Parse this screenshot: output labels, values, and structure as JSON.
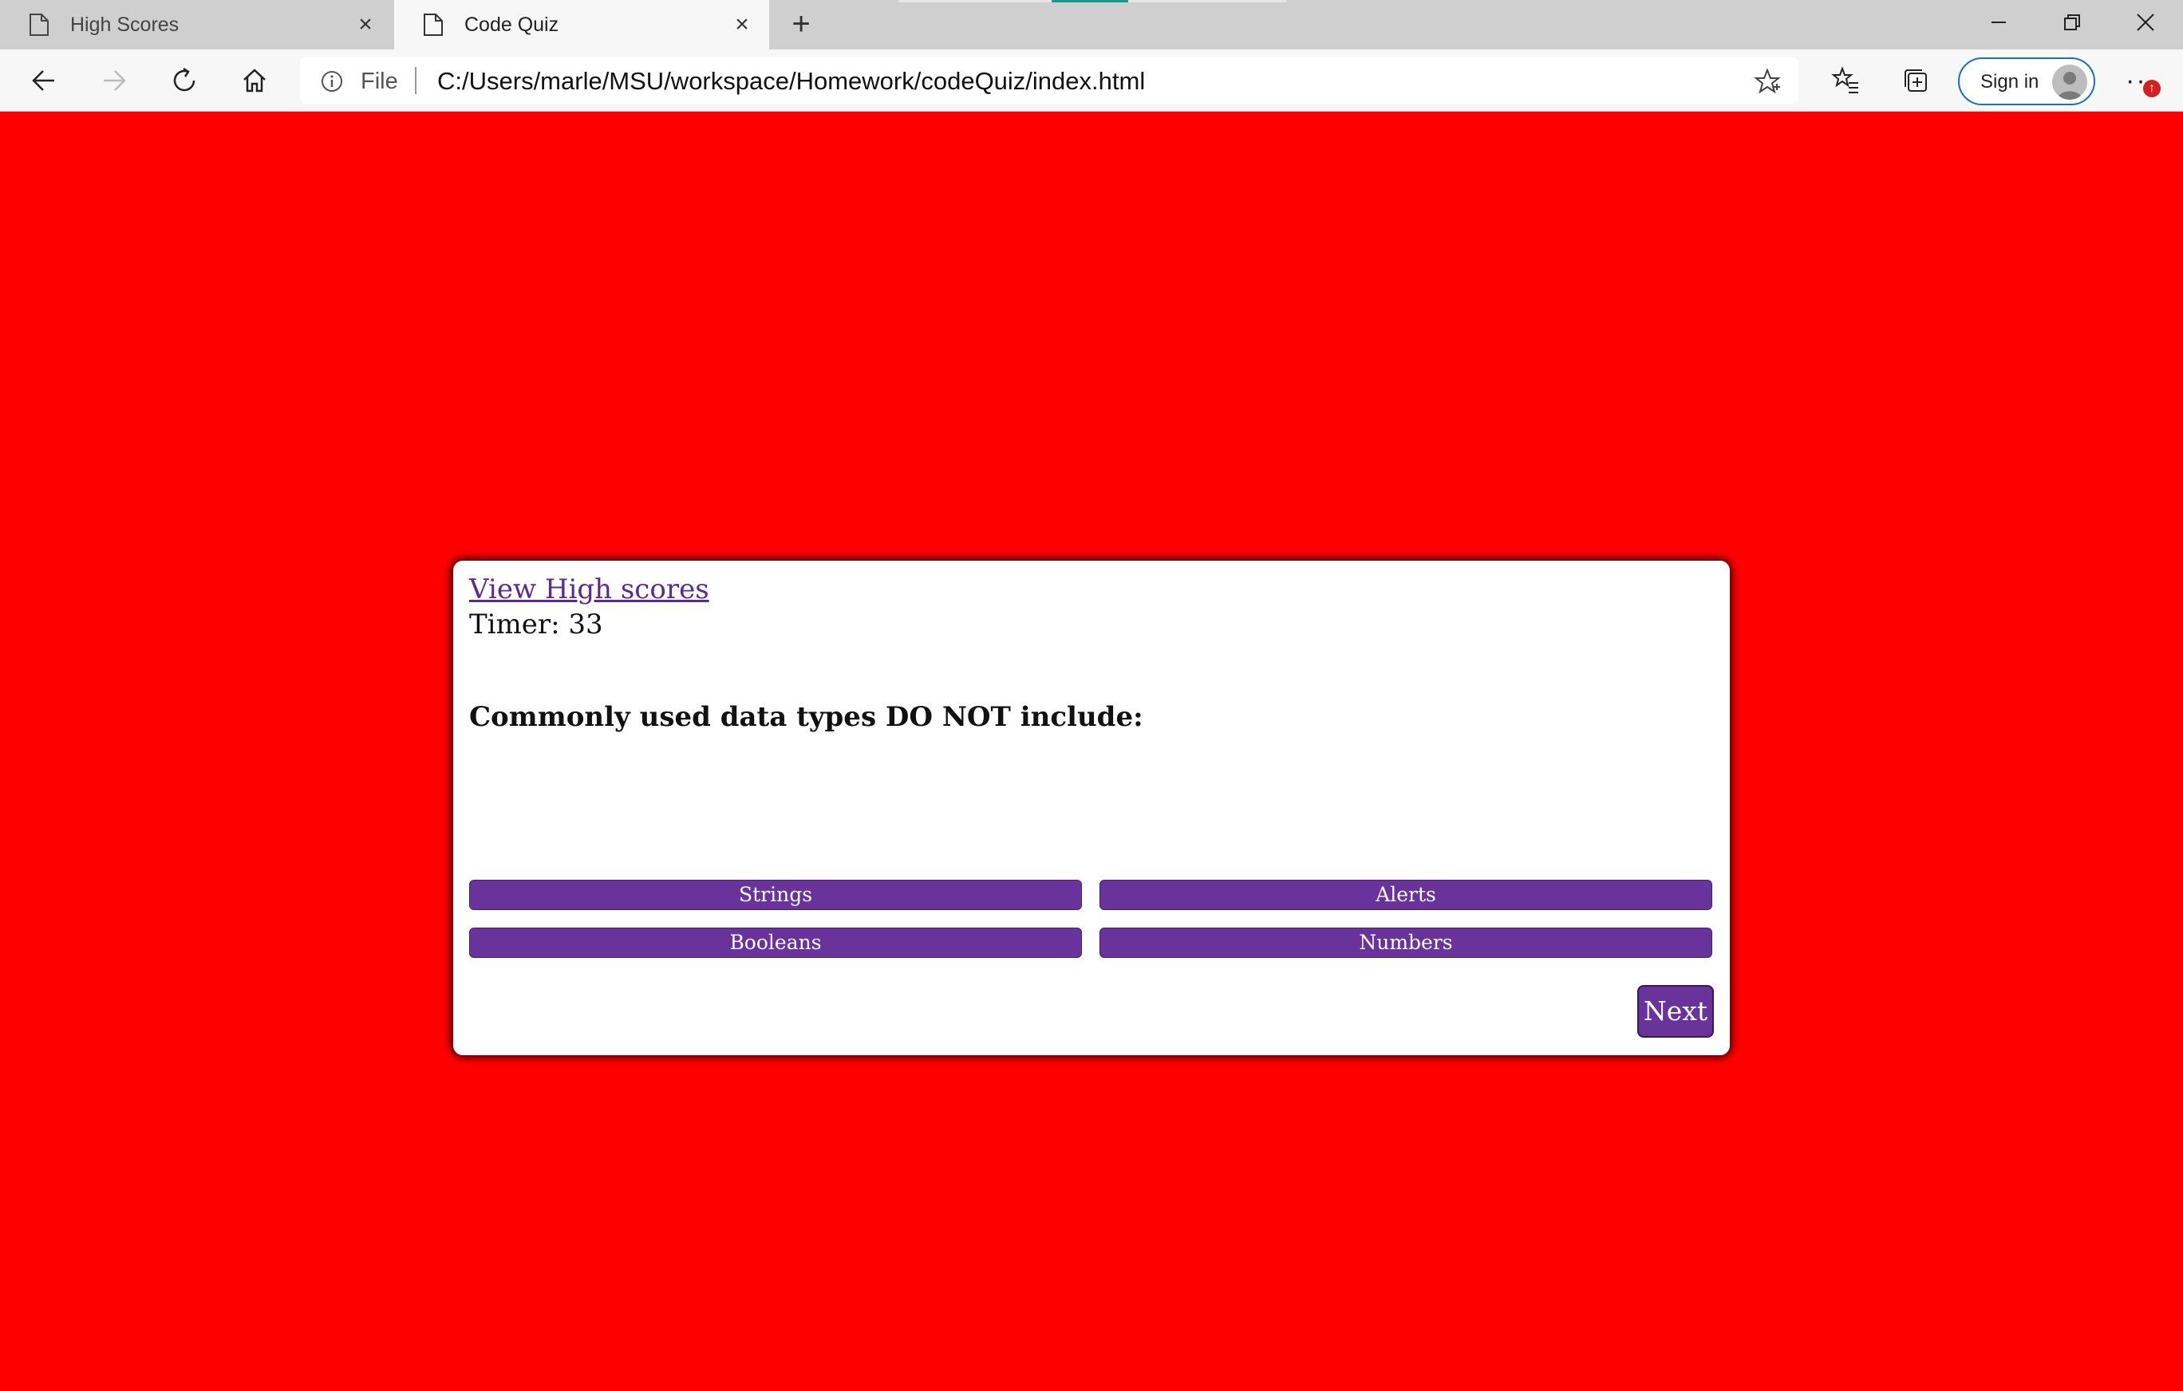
{
  "browser": {
    "tabs": [
      {
        "title": "High Scores",
        "active": false
      },
      {
        "title": "Code Quiz",
        "active": true
      }
    ],
    "address_bar": {
      "scheme_label": "File",
      "url": "C:/Users/marle/MSU/workspace/Homework/codeQuiz/index.html"
    },
    "sign_in_label": "Sign in",
    "more_label": "···",
    "update_badge": "↑",
    "accent_color": "#1a6fc4"
  },
  "quiz": {
    "high_scores_link": "View High scores",
    "timer_text": "Timer: 33",
    "question": "Commonly used data types DO NOT include:",
    "answers": [
      "Strings",
      "Alerts",
      "Booleans",
      "Numbers"
    ],
    "next_label": "Next"
  },
  "colors": {
    "page_background": "#ff0000",
    "button_purple": "#6a339c",
    "card_background": "#ffffff"
  }
}
